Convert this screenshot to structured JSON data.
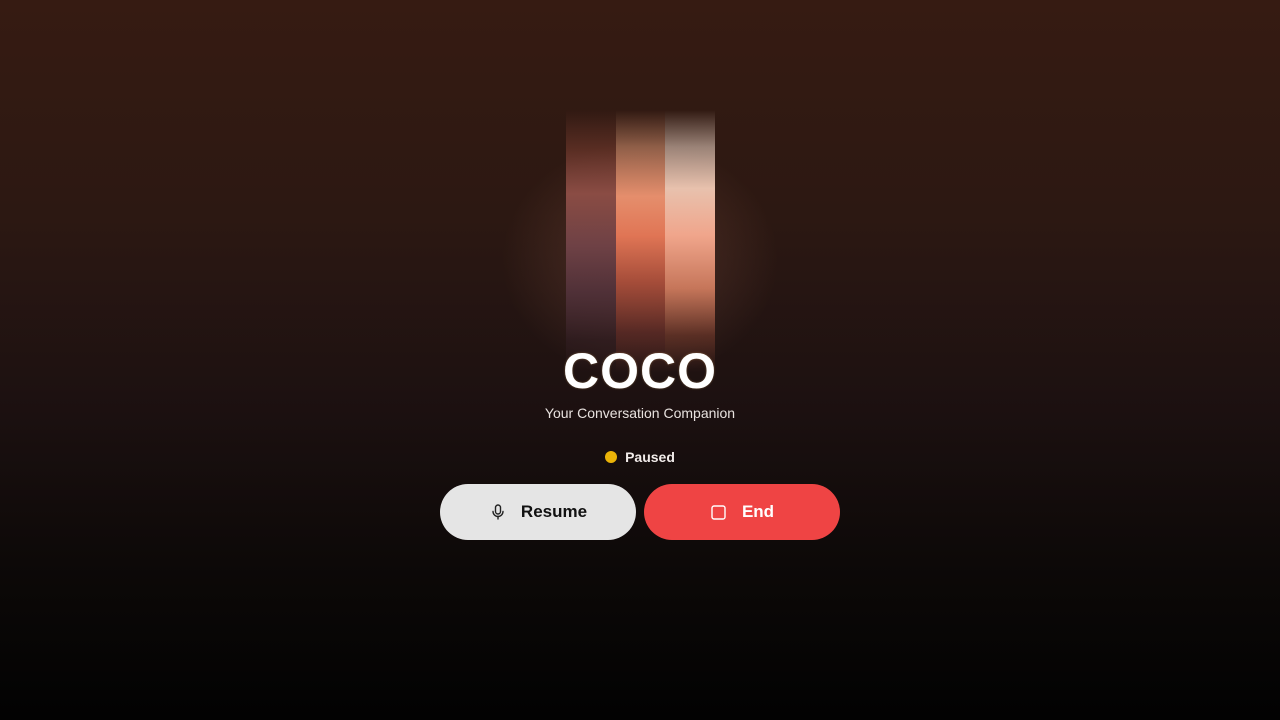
{
  "app": {
    "title": "COCO",
    "subtitle": "Your Conversation Companion"
  },
  "status": {
    "label": "Paused",
    "color": "#eab308"
  },
  "controls": {
    "resume_label": "Resume",
    "resume_icon": "microphone-icon",
    "end_label": "End",
    "end_icon": "stop-square-icon"
  },
  "colors": {
    "end_button": "#ef4444",
    "resume_button": "#e5e5e5",
    "visualizer_bars": [
      "#8a4c44",
      "#e07555",
      "#f0a58b"
    ]
  }
}
